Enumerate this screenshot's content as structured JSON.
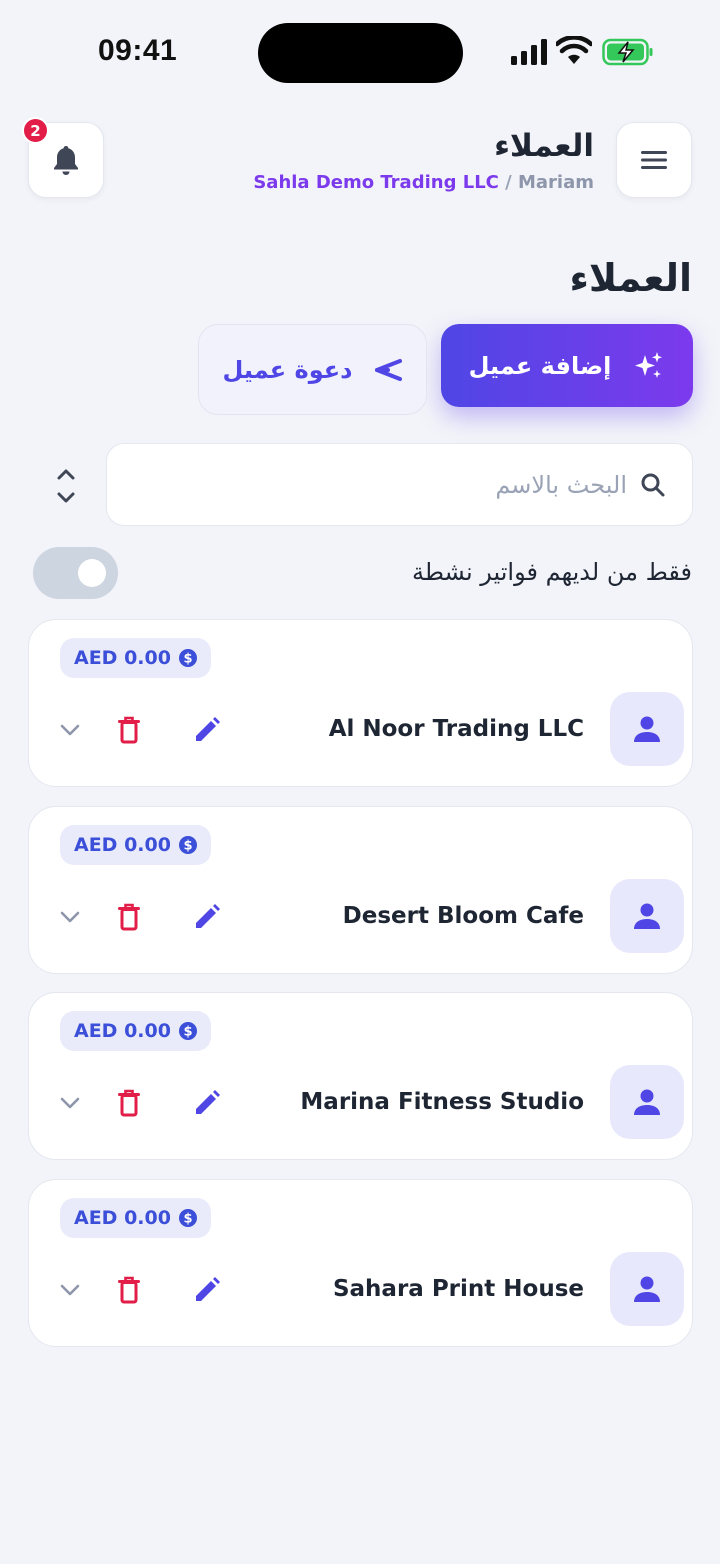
{
  "status_bar": {
    "time": "09:41"
  },
  "header": {
    "title": "العملاء",
    "org": "Sahla Demo Trading LLC",
    "separator": " / ",
    "user": "Mariam",
    "notification_count": "2"
  },
  "page": {
    "title": "العملاء",
    "add_button_label": "إضافة عميل",
    "invite_button_label": "دعوة عميل",
    "search_placeholder": "البحث بالاسم",
    "search_value": "",
    "filter_label": "فقط من لديهم فواتير نشطة",
    "filter_active": false
  },
  "customers": [
    {
      "name": "Al Noor Trading LLC",
      "balance": "AED 0.00"
    },
    {
      "name": "Desert Bloom Cafe",
      "balance": "AED 0.00"
    },
    {
      "name": "Marina Fitness Studio",
      "balance": "AED 0.00"
    },
    {
      "name": "Sahara Print House",
      "balance": "AED 0.00"
    }
  ],
  "colors": {
    "accent": "#4f46e5",
    "accent_gradient_end": "#7c3aed",
    "danger": "#e11d48",
    "background": "#f3f4f9"
  },
  "icons": [
    "bell-icon",
    "menu-icon",
    "sparkles-icon",
    "send-icon",
    "search-icon",
    "sort-icon",
    "dollar-icon",
    "user-icon",
    "edit-icon",
    "trash-icon",
    "chevron-down-icon"
  ]
}
